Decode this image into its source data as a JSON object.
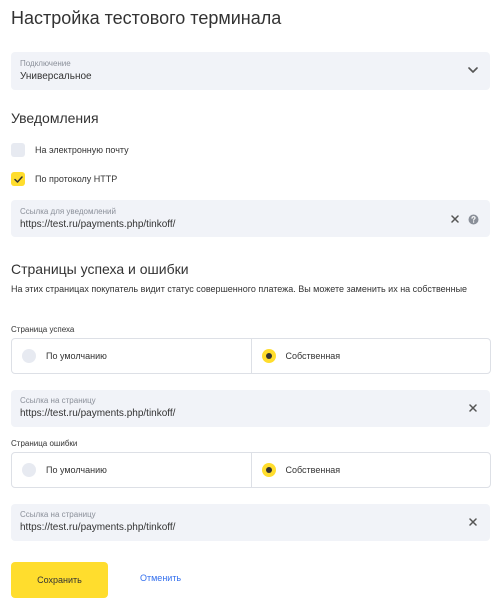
{
  "page": {
    "title": "Настройка тестового терминала"
  },
  "connection": {
    "label": "Подключение",
    "value": "Универсальное",
    "icon": "chevron-down-icon"
  },
  "notifications": {
    "title": "Уведомления",
    "email": {
      "label": "На электронную почту",
      "checked": false
    },
    "http": {
      "label": "По протоколу HTTP",
      "checked": true
    },
    "url_field": {
      "label": "Ссылка для уведомлений",
      "value": "https://test.ru/payments.php/tinkoff/"
    }
  },
  "pages": {
    "title": "Страницы успеха и ошибки",
    "description": "На этих страницах покупатель видит статус совершенного платежа. Вы можете заменить их на собственные",
    "success": {
      "label": "Страница успеха",
      "options": [
        "По умолчанию",
        "Собственная"
      ],
      "selected": "Собственная",
      "url_label": "Ссылка на страницу",
      "url_value": "https://test.ru/payments.php/tinkoff/"
    },
    "error": {
      "label": "Страница ошибки",
      "options": [
        "По умолчанию",
        "Собственная"
      ],
      "selected": "Собственная",
      "url_label": "Ссылка на страницу",
      "url_value": "https://test.ru/payments.php/tinkoff/"
    }
  },
  "actions": {
    "save": "Сохранить",
    "cancel": "Отменить"
  },
  "colors": {
    "accent": "#ffdd2d",
    "field_bg": "#f1f3f8",
    "link": "#336fee"
  }
}
